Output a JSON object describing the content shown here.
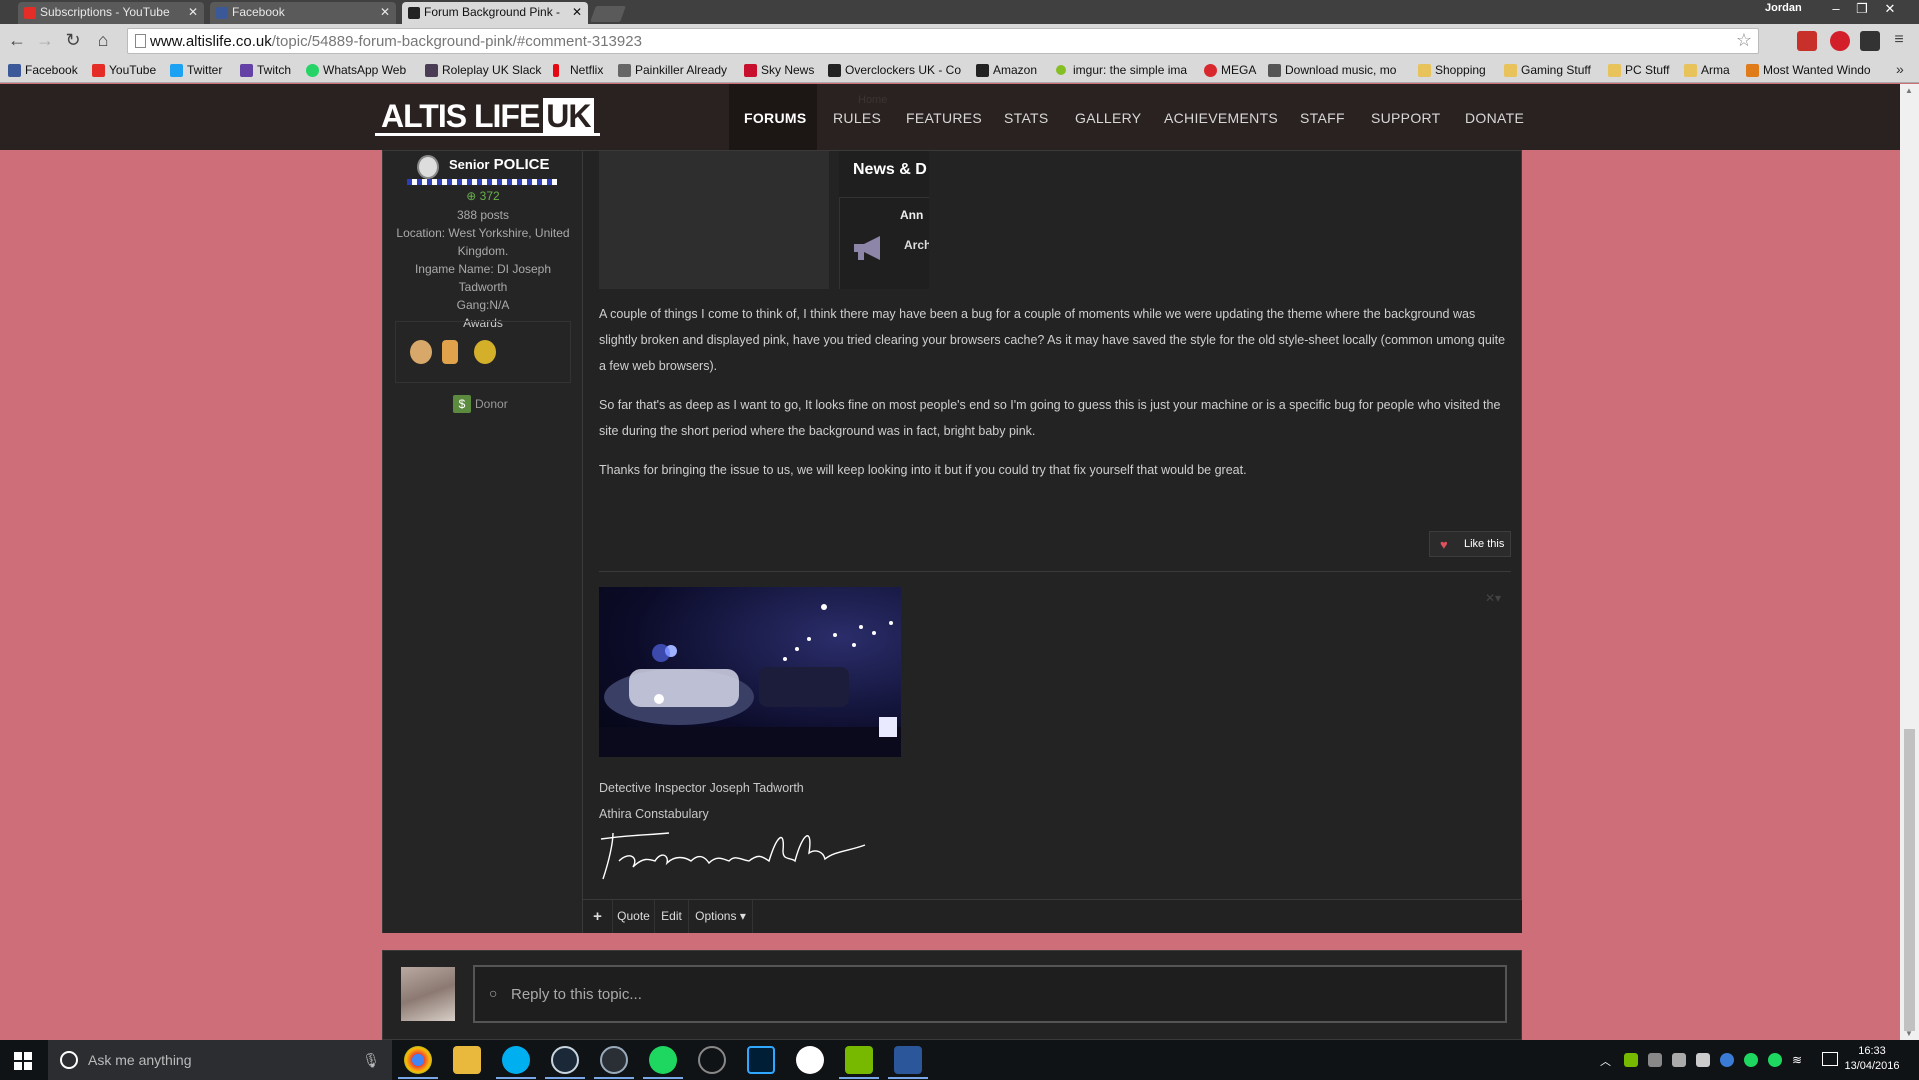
{
  "browser": {
    "tabs": [
      {
        "label": "Subscriptions - YouTube",
        "icon": "youtube-icon",
        "color": "#e52d27"
      },
      {
        "label": "Facebook",
        "icon": "facebook-icon",
        "color": "#3b5998"
      },
      {
        "label": "Forum Background Pink -",
        "icon": "altislife-icon",
        "color": "#222222"
      }
    ],
    "user": "Jordan",
    "url_domain": "www.altislife.co.uk",
    "url_path": "/topic/54889-forum-background-pink/#comment-313923"
  },
  "bookmarks": [
    {
      "label": "Facebook",
      "icon": "facebook-icon",
      "color": "#3b5998"
    },
    {
      "label": "YouTube",
      "icon": "youtube-icon",
      "color": "#e52d27"
    },
    {
      "label": "Twitter",
      "icon": "twitter-icon",
      "color": "#1da1f2"
    },
    {
      "label": "Twitch",
      "icon": "twitch-icon",
      "color": "#6441a5"
    },
    {
      "label": "WhatsApp Web",
      "icon": "whatsapp-icon",
      "color": "#25d366"
    },
    {
      "label": "Roleplay UK Slack",
      "icon": "slack-icon",
      "color": "#4a3c54"
    },
    {
      "label": "Netflix",
      "icon": "netflix-icon",
      "color": "#e50914"
    },
    {
      "label": "Painkiller Already",
      "icon": "painkiller-icon",
      "color": "#666666"
    },
    {
      "label": "Sky News",
      "icon": "skynews-icon",
      "color": "#c8102e"
    },
    {
      "label": "Overclockers UK - Co",
      "icon": "overclockers-icon",
      "color": "#222222"
    },
    {
      "label": "Amazon",
      "icon": "amazon-icon",
      "color": "#222222"
    },
    {
      "label": "imgur: the simple ima",
      "icon": "imgur-icon",
      "color": "#85bf25"
    },
    {
      "label": "MEGA",
      "icon": "mega-icon",
      "color": "#d9272e"
    },
    {
      "label": "Download music, mo",
      "icon": "download-icon",
      "color": "#555555"
    },
    {
      "label": "Shopping",
      "icon": "folder-icon",
      "color": "#e8c25a"
    },
    {
      "label": "Gaming Stuff",
      "icon": "folder-icon",
      "color": "#e8c25a"
    },
    {
      "label": "PC Stuff",
      "icon": "folder-icon",
      "color": "#e8c25a"
    },
    {
      "label": "Arma",
      "icon": "folder-icon",
      "color": "#e8c25a"
    },
    {
      "label": "Most Wanted Windo",
      "icon": "mostwanted-icon",
      "color": "#e07b1a"
    }
  ],
  "site": {
    "logo_main": "ALTIS LIFE",
    "logo_suffix": "UK",
    "breadcrumb": "Home",
    "nav": [
      "FORUMS",
      "RULES",
      "FEATURES",
      "STATS",
      "GALLERY",
      "ACHIEVEMENTS",
      "STAFF",
      "SUPPORT",
      "DONATE"
    ],
    "active_nav": "FORUMS"
  },
  "author": {
    "rank_prefix": "Senior",
    "rank": "POLICE",
    "reputation": "372",
    "posts": "388 posts",
    "location": "Location: West Yorkshire, United Kingdom.",
    "ingame": "Ingame Name: DI Joseph Tadworth",
    "gang": "Gang:N/A",
    "awards_label": "Awards",
    "donor": "Donor"
  },
  "post": {
    "embed_title": "News & D",
    "embed_sub1": "Ann",
    "embed_sub2": "Arch",
    "paragraphs": [
      "A couple of things I come to think of, I think there may have been a bug for a couple of moments while we were updating the theme where the background was slightly broken and displayed pink, have you tried clearing your browsers cache? As it may have saved the style for the old style-sheet locally (common umong quite a few web browsers).",
      "So far that's as deep as I want to go, It looks fine on most people's end so I'm going to guess this is just your machine or is a specific bug for people who visited the site during the short period where the background was in fact, bright baby pink.",
      "Thanks for bringing the issue to us, we will keep looking into it but if you could try that fix yourself that would be great."
    ],
    "like_label": "Like this",
    "signature_line1": "Detective Inspector Joseph Tadworth",
    "signature_line2": "Athira Constabulary",
    "actions": {
      "plus": "+",
      "quote": "Quote",
      "edit": "Edit",
      "options": "Options"
    }
  },
  "reply": {
    "placeholder": "Reply to this topic..."
  },
  "taskbar": {
    "search_placeholder": "Ask me anything",
    "time": "16:33",
    "date": "13/04/2016"
  },
  "colors": {
    "page_background": "#cd6e78",
    "header": "#2a2220",
    "post_bg": "#232323"
  }
}
